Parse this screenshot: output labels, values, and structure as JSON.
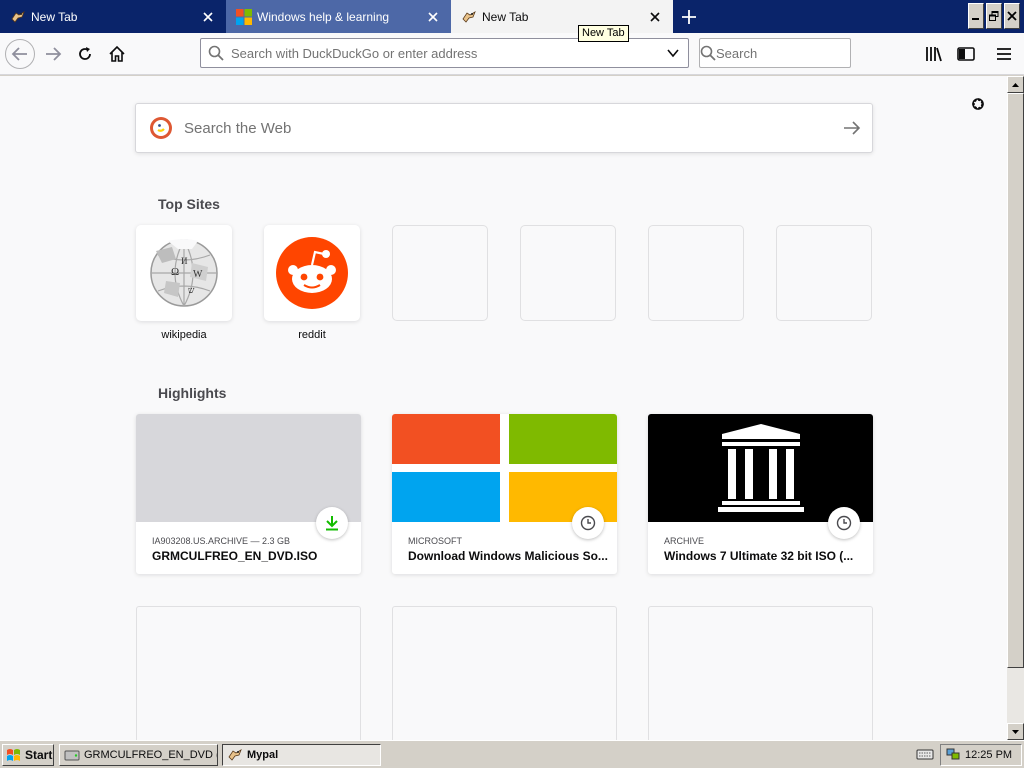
{
  "tabs": [
    {
      "title": "New Tab",
      "icon": "mypal-icon",
      "active": false
    },
    {
      "title": "Windows help & learning",
      "icon": "microsoft-logo",
      "active": false
    },
    {
      "title": "New Tab",
      "icon": "mypal-icon",
      "active": true
    }
  ],
  "tooltip": "New Tab",
  "urlbar": {
    "placeholder": "Search with DuckDuckGo or enter address"
  },
  "searchbar": {
    "placeholder": "Search"
  },
  "newtab": {
    "search_placeholder": "Search the Web",
    "top_sites_title": "Top Sites",
    "top_sites": [
      {
        "label": "wikipedia",
        "icon": "wikipedia-globe"
      },
      {
        "label": "reddit",
        "icon": "reddit-alien"
      },
      {
        "label": ""
      },
      {
        "label": ""
      },
      {
        "label": ""
      },
      {
        "label": ""
      }
    ],
    "highlights_title": "Highlights",
    "highlights": [
      {
        "context": "IA903208.US.ARCHIVE — 2.3 GB",
        "title": "GRMCULFREO_EN_DVD.ISO",
        "badge": "download-icon",
        "thumb": "grey-placeholder"
      },
      {
        "context": "MICROSOFT",
        "title": "Download Windows Malicious So...",
        "badge": "clock-icon",
        "thumb": "microsoft-logo"
      },
      {
        "context": "ARCHIVE",
        "title": "Windows 7 Ultimate 32 bit ISO (...",
        "badge": "clock-icon",
        "thumb": "archive-logo"
      }
    ]
  },
  "taskbar": {
    "start": "Start",
    "items": [
      {
        "label": "GRMCULFREO_EN_DVD (...",
        "active": false
      },
      {
        "label": "Mypal",
        "active": true
      }
    ],
    "clock": "12:25 PM"
  },
  "colors": {
    "titlebar": "#0a246a",
    "inactive_tab": "#4d68a7",
    "reddit": "#ff4500",
    "download_green": "#12bc00"
  }
}
